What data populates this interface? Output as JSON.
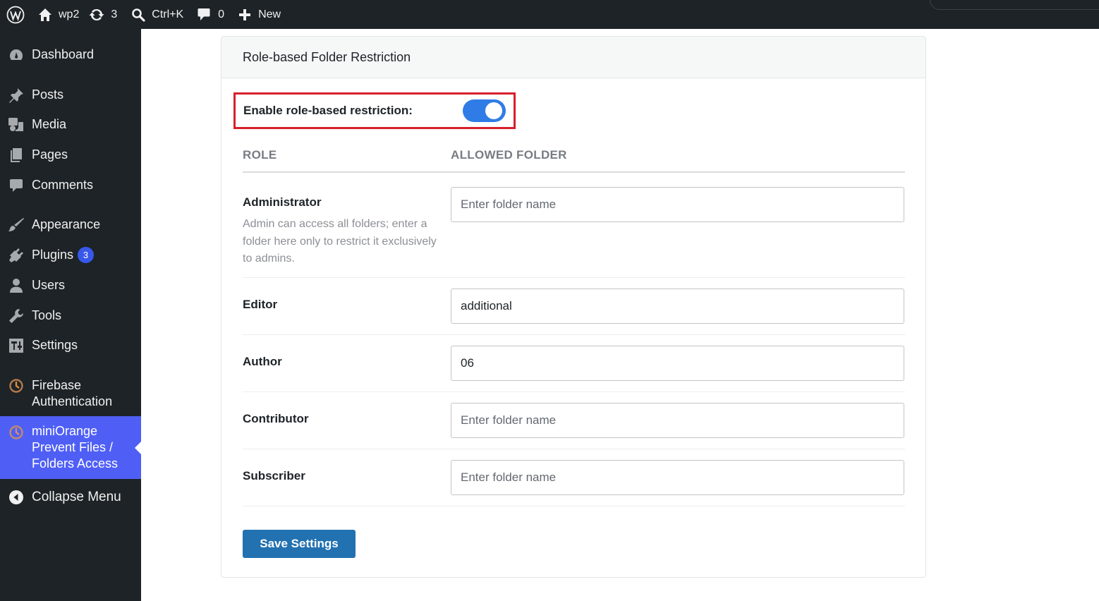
{
  "adminbar": {
    "site_name": "wp2",
    "updates_count": "3",
    "search_shortcut": "Ctrl+K",
    "comments_count": "0",
    "new_label": "New"
  },
  "sidebar": {
    "items": [
      {
        "label": "Dashboard",
        "icon": "dashboard-icon"
      },
      {
        "label": "Posts",
        "icon": "pin-icon"
      },
      {
        "label": "Media",
        "icon": "media-icon"
      },
      {
        "label": "Pages",
        "icon": "pages-icon"
      },
      {
        "label": "Comments",
        "icon": "comment-icon"
      },
      {
        "label": "Appearance",
        "icon": "brush-icon"
      },
      {
        "label": "Plugins",
        "icon": "plugin-icon",
        "badge": "3"
      },
      {
        "label": "Users",
        "icon": "user-icon"
      },
      {
        "label": "Tools",
        "icon": "wrench-icon"
      },
      {
        "label": "Settings",
        "icon": "settings-icon"
      },
      {
        "label": "Firebase Authentication",
        "icon": "firebase-icon"
      },
      {
        "label": "miniOrange Prevent Files / Folders Access",
        "icon": "miniorange-icon",
        "current": true
      },
      {
        "label": "Collapse Menu",
        "icon": "collapse-icon"
      }
    ]
  },
  "panel": {
    "title": "Role-based Folder Restriction",
    "toggle_label": "Enable role-based restriction:",
    "toggle_on": true,
    "col_role": "ROLE",
    "col_folder": "ALLOWED FOLDER",
    "roles": [
      {
        "name": "Administrator",
        "description": "Admin can access all folders; enter a folder here only to restrict it exclusively to admins.",
        "value": "",
        "placeholder": "Enter folder name"
      },
      {
        "name": "Editor",
        "value": "additional",
        "placeholder": "Enter folder name"
      },
      {
        "name": "Author",
        "value": "06",
        "placeholder": "Enter folder name"
      },
      {
        "name": "Contributor",
        "value": "",
        "placeholder": "Enter folder name"
      },
      {
        "name": "Subscriber",
        "value": "",
        "placeholder": "Enter folder name"
      }
    ],
    "save_label": "Save Settings"
  },
  "colors": {
    "adminbar_bg": "#1d2327",
    "menu_current": "#4f5ff5",
    "toggle_on": "#2f7ce6",
    "highlight_border": "#d6202c",
    "primary_button": "#2271b1"
  }
}
